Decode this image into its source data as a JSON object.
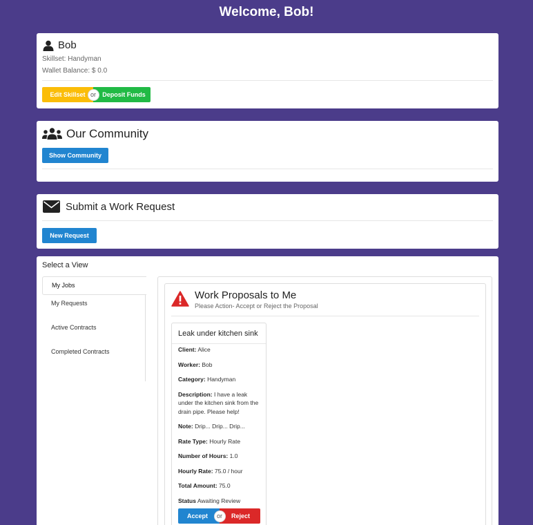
{
  "welcome": "Welcome, Bob!",
  "profile": {
    "name": "Bob",
    "skillset": "Skillset: Handyman",
    "wallet": "Wallet Balance: $ 0.0",
    "edit_label": "Edit Skillset",
    "or_label": "or",
    "deposit_label": "Deposit Funds"
  },
  "community": {
    "title": "Our Community",
    "show_label": "Show Community"
  },
  "request": {
    "title": "Submit a Work Request",
    "new_label": "New Request"
  },
  "views": {
    "title": "Select a View",
    "tabs": [
      "My Jobs",
      "My Requests",
      "Active Contracts",
      "Completed Contracts"
    ]
  },
  "proposals": {
    "title": "Work Proposals to Me",
    "subtitle": "Please Action- Accept or Reject the Proposal",
    "card": {
      "title": "Leak under kitchen sink",
      "fields": [
        {
          "label": "Client:",
          "value": "Alice"
        },
        {
          "label": "Worker:",
          "value": "Bob"
        },
        {
          "label": "Category:",
          "value": "Handyman"
        },
        {
          "label": "Description:",
          "value": "I have a leak under the kitchen sink from the drain pipe. Please help!"
        },
        {
          "label": "Note:",
          "value": "Drip... Drip... Drip..."
        },
        {
          "label": "Rate Type:",
          "value": "Hourly Rate"
        },
        {
          "label": "Number of Hours:",
          "value": "1.0"
        },
        {
          "label": "Hourly Rate:",
          "value": "75.0 / hour"
        },
        {
          "label": "Total Amount:",
          "value": "75.0"
        },
        {
          "label": "Status",
          "value": "Awaiting Review"
        }
      ],
      "accept_label": "Accept",
      "or_label": "or",
      "reject_label": "Reject"
    }
  },
  "icons": {
    "user": "user-icon",
    "users": "users-icon",
    "mail": "envelope-icon",
    "warning": "warning-icon"
  },
  "colors": {
    "background": "#4b3c8a",
    "blue": "#2185d0",
    "yellow": "#fbbd08",
    "green": "#21ba45",
    "red": "#db2828"
  }
}
